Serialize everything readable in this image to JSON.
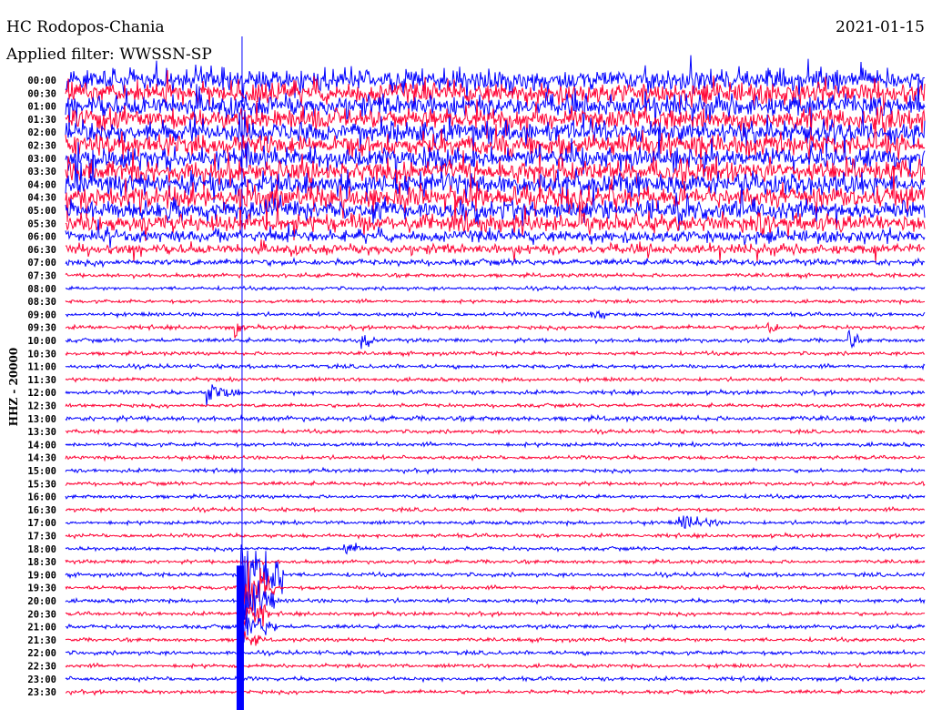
{
  "chart_data": {
    "type": "line",
    "title": "HC Rodopos-Chania",
    "subtitle": "Applied filter: WWSSN-SP",
    "date": "2021-01-15",
    "ylabel": "HHZ - 20000",
    "xlabel": "",
    "minutes_per_line": 30,
    "row_labels": [
      "00:00",
      "00:30",
      "01:00",
      "01:30",
      "02:00",
      "02:30",
      "03:00",
      "03:30",
      "04:00",
      "04:30",
      "05:00",
      "05:30",
      "06:00",
      "06:30",
      "07:00",
      "07:30",
      "08:00",
      "08:30",
      "09:00",
      "09:30",
      "10:00",
      "10:30",
      "11:00",
      "11:30",
      "12:00",
      "12:30",
      "13:00",
      "13:30",
      "14:00",
      "14:30",
      "15:00",
      "15:30",
      "16:00",
      "16:30",
      "17:00",
      "17:30",
      "18:00",
      "18:30",
      "19:00",
      "19:30",
      "20:00",
      "20:30",
      "21:00",
      "21:30",
      "22:00",
      "22:30",
      "23:00",
      "23:30"
    ],
    "colors": {
      "hour": "#0000ff",
      "half_hour": "#ff0033"
    },
    "noise_amplitude": [
      9,
      9,
      9,
      9,
      9,
      9,
      9,
      9,
      9,
      9,
      8,
      7,
      5,
      4,
      2.5,
      1.6,
      1.4,
      1.4,
      1.5,
      1.6,
      1.6,
      1.5,
      1.6,
      1.5,
      1.6,
      1.5,
      2,
      1.5,
      1.6,
      1.5,
      1.5,
      1.5,
      1.5,
      1.5,
      1.5,
      1.5,
      1.5,
      1.5,
      1.6,
      1.5,
      1.6,
      1.5,
      1.6,
      1.5,
      1.6,
      1.5,
      1.6,
      1.5
    ],
    "events": [
      {
        "row": 38,
        "minute": 6.1,
        "amplitude": 50,
        "duration_min": 1.5
      },
      {
        "row": 39,
        "minute": 6.1,
        "amplitude": 30,
        "duration_min": 1.2
      },
      {
        "row": 40,
        "minute": 6.1,
        "amplitude": 25,
        "duration_min": 1.2
      },
      {
        "row": 41,
        "minute": 6.1,
        "amplitude": 20,
        "duration_min": 1
      },
      {
        "row": 42,
        "minute": 6.1,
        "amplitude": 14,
        "duration_min": 1.3
      },
      {
        "row": 43,
        "minute": 6.1,
        "amplitude": 9,
        "duration_min": 0.8
      },
      {
        "row": 24,
        "minute": 4.9,
        "amplitude": 10,
        "duration_min": 1.2
      },
      {
        "row": 34,
        "minute": 21.4,
        "amplitude": 8,
        "duration_min": 1.4
      },
      {
        "row": 36,
        "minute": 9.7,
        "amplitude": 7,
        "duration_min": 0.8
      },
      {
        "row": 20,
        "minute": 10.3,
        "amplitude": 9,
        "duration_min": 0.5
      },
      {
        "row": 19,
        "minute": 5.9,
        "amplitude": 14,
        "duration_min": 0.3
      },
      {
        "row": 18,
        "minute": 18.3,
        "amplitude": 8,
        "duration_min": 0.6
      },
      {
        "row": 19,
        "minute": 24.5,
        "amplitude": 10,
        "duration_min": 0.4
      },
      {
        "row": 20,
        "minute": 27.3,
        "amplitude": 12,
        "duration_min": 0.4
      }
    ]
  }
}
